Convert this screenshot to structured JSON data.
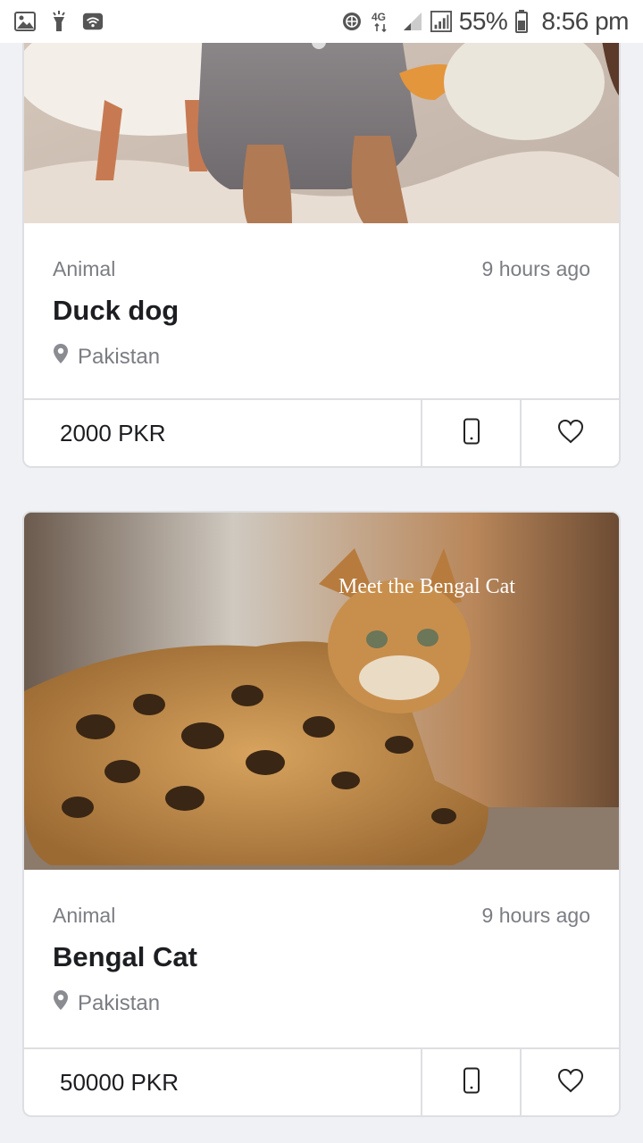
{
  "status_bar": {
    "battery": "55%",
    "time": "8:56 pm",
    "network": "4G"
  },
  "listings": [
    {
      "image_alt": "",
      "category": "Animal",
      "time_ago": "9 hours ago",
      "title": "Duck dog",
      "location": "Pakistan",
      "price": "2000 PKR"
    },
    {
      "image_caption": "Meet the Bengal Cat",
      "category": "Animal",
      "time_ago": "9 hours ago",
      "title": "Bengal Cat",
      "location": "Pakistan",
      "price": "50000 PKR"
    }
  ],
  "icons": {
    "location": "location-pin-icon",
    "call": "mobile-phone-icon",
    "favorite": "heart-icon"
  },
  "colors": {
    "background": "#f0f1f5",
    "card_border": "#dedfe3",
    "muted_text": "#7b7d83",
    "title_text": "#1d1e22"
  }
}
